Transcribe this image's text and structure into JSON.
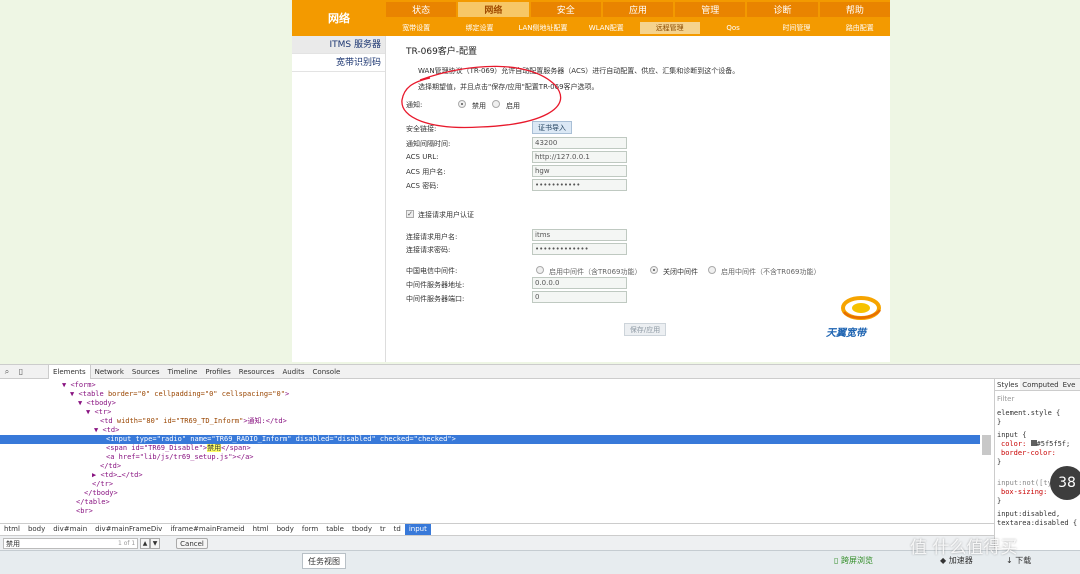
{
  "router": {
    "brand": "网络",
    "main_nav": [
      "状态",
      "网络",
      "安全",
      "应用",
      "管理",
      "诊断",
      "帮助"
    ],
    "main_nav_active": 1,
    "sub_nav": [
      "宽带设置",
      "绑定设置",
      "LAN侧地址配置",
      "WLAN配置",
      "远程管理",
      "Qos",
      "时间管理",
      "路由配置"
    ],
    "sub_nav_active": 4,
    "left_menu": [
      "ITMS 服务器",
      "宽带识别码"
    ],
    "title": "TR-069客户-配置",
    "desc1": "WAN管理协议（TR-069）允许自动配置服务器（ACS）进行自动配置、供应、汇集和诊断到这个设备。",
    "desc2": "选择期望值，并且点击\"保存/应用\"配置TR-069客户选项。",
    "inform_label": "通知:",
    "inform_disable": "禁用",
    "inform_enable": "启用",
    "ssl_label": "安全链接:",
    "cert_import": "证书导入",
    "fields": [
      {
        "label": "通知间隔时间:",
        "value": "43200"
      },
      {
        "label": "ACS URL:",
        "value": "http://127.0.0.1"
      },
      {
        "label": "ACS 用户名:",
        "value": "hgw"
      },
      {
        "label": "ACS 密码:",
        "value": "•••••••••••"
      }
    ],
    "conn_auth": "连接请求用户认证",
    "conn_fields": [
      {
        "label": "连接请求用户名:",
        "value": "itms"
      },
      {
        "label": "连接请求密码:",
        "value": "•••••••••••••"
      }
    ],
    "middleware_label": "中国电信中间件:",
    "middleware_options": [
      "启用中间件（含TR069功能）",
      "关闭中间件",
      "启用中间件（不含TR069功能）"
    ],
    "middleware_fields": [
      {
        "label": "中间件服务器地址:",
        "value": "0.0.0.0"
      },
      {
        "label": "中间件服务器端口:",
        "value": "0"
      }
    ],
    "save_apply": "保存/应用",
    "logo_text": "天翼宽带"
  },
  "devtools": {
    "tabs": [
      "Elements",
      "Network",
      "Sources",
      "Timeline",
      "Profiles",
      "Resources",
      "Audits",
      "Console"
    ],
    "active_tab": 0,
    "dom": {
      "l0": "<form>",
      "l1_tag": "<table",
      "l1_attrs": " border=\"0\" cellpadding=\"0\" cellspacing=\"0\"",
      "l1_end": ">",
      "l2": "<tbody>",
      "l3": "<tr>",
      "l4_open": "<td",
      "l4_attrs": " width=\"80\" id=\"TR69_TD_Inform\"",
      "l4_text": ">通知:</td>",
      "l5": "<td>",
      "l6": "<input type=\"radio\" name=\"TR69_RADIO_Inform\" disabled=\"disabled\" checked=\"checked\">",
      "l7_open": "<span id=\"TR69_Disable\">",
      "l7_hl": "禁用",
      "l7_close": "</span>",
      "l8": "<a href=\"lib/js/tr69_setup.js\"></a>",
      "l9": "</td>",
      "l10": "<td>…</td>",
      "l11": "</tr>",
      "l12": "</tbody>",
      "l13": "</table>",
      "l14": "<br>"
    },
    "styles_tabs": [
      "Styles",
      "Computed",
      "Eve"
    ],
    "styles": {
      "filter": "Filter",
      "element_style": "element.style {",
      "brace_close": "}",
      "input_rule": "input {",
      "color_prop": "color:",
      "color_val": "#5f5f5f;",
      "border_prop": "border-color:",
      "not_rule": "input:not([ty",
      "box_sizing": "box-sizing:",
      "disabled_rule": "input:disabled,",
      "textarea_rule": "textarea:disabled {"
    },
    "breadcrumbs": [
      "html",
      "body",
      "div#main",
      "div#mainFrameDiv",
      "iframe#mainFrameid",
      "html",
      "body",
      "form",
      "table",
      "tbody",
      "tr",
      "td",
      "input"
    ],
    "find_value": "禁用",
    "find_count": "1 of 1",
    "find_cancel": "Cancel"
  },
  "badge": "38",
  "taskbar": {
    "task_view": "任务视图",
    "cross_screen": "跨屏浏览",
    "accelerator": "加速器",
    "download": "下载"
  },
  "watermark": "值 什么值得买",
  "colors": {
    "orange": "#f39a00",
    "selection": "#3879d9",
    "annotation_red": "#e8192c"
  }
}
